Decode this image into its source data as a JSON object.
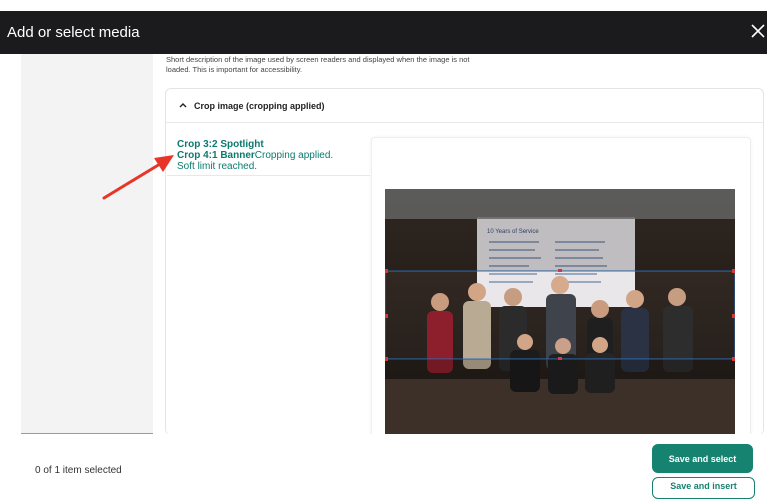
{
  "dialog": {
    "title": "Add or select media",
    "close_icon": "close-icon"
  },
  "alt_description": "Short description of the image used by screen readers and displayed when the image is not loaded. This is important for accessibility.",
  "crop_panel": {
    "header_icon": "chevron-up-icon",
    "header_label": "Crop image (cropping applied)",
    "items": [
      {
        "label": "Crop 3:2 Spotlight"
      },
      {
        "label": "Crop 4:1 Banner",
        "status": "Cropping applied.",
        "note": "Soft limit reached."
      }
    ]
  },
  "photo_slide": {
    "heading": "10 Years of Service"
  },
  "footer": {
    "selected_count": "0 of 1 item selected",
    "save_label": "Save and select",
    "second_label": "Save and insert"
  },
  "colors": {
    "titlebar": "#1b1b1d",
    "accent": "#168270",
    "link": "#0b7a6e",
    "annotation_arrow": "#e8352a"
  }
}
